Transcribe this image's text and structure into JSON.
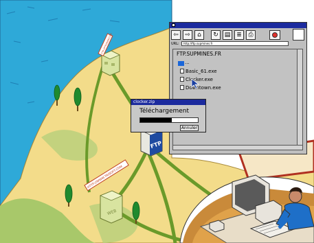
{
  "colors": {
    "sea": "#2ea9d8",
    "land": "#f3dc8a",
    "grass": "#a8c86a",
    "network_line": "#6a9a2a",
    "titlebar": "#1c2b9e",
    "window_bg": "#bfbfbf"
  },
  "server_signs": {
    "ftp_top_sign": "FTP://FTP.WWW.COM",
    "web_sign": "HTTP://WWW.TRISOFT.COM",
    "ftp_label": "FTP",
    "web_label": "WEB"
  },
  "browser": {
    "url_label": "URL:",
    "url_value": "http://ftp.supmines.fr",
    "host_title": "FTP.SUPMINES.FR",
    "parent_folder": "...",
    "files": [
      "Basic_61.exe",
      "Clocker.exe",
      "Downtown.exe"
    ],
    "toolbar_icons": [
      "back-arrow-icon",
      "forward-arrow-icon",
      "home-icon",
      "reload-icon",
      "open-icon",
      "print-icon",
      "find-icon",
      "stop-icon"
    ]
  },
  "dialog": {
    "title": "clocker.zip",
    "label": "Téléchargement",
    "cancel_label": "Annuler",
    "progress": 0.55
  }
}
